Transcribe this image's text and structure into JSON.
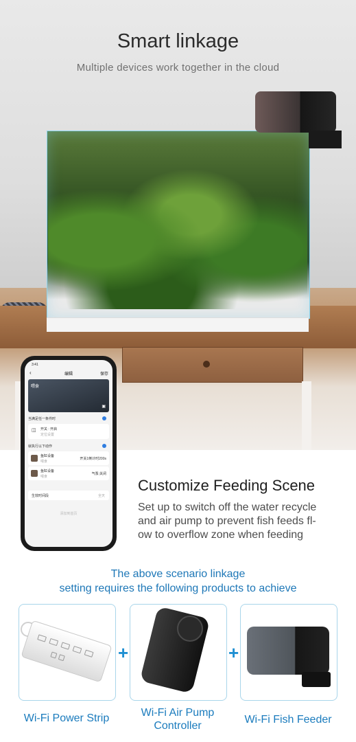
{
  "hero": {
    "title": "Smart linkage",
    "subtitle": "Multiple devices work together in the cloud"
  },
  "phone": {
    "status_time": "3:41",
    "back_icon": "chevron-left-icon",
    "title": "编辑",
    "save_label": "保存",
    "card_label": "喂食",
    "condition_header": "当满足任一条件时",
    "condition_row": "开关 : 开启",
    "condition_sub": "定位设置",
    "action_header": "就执行以下动作",
    "action_rows": [
      {
        "name": "鱼缸设备",
        "sub": "喂食",
        "value": "开关1倒计时200s"
      },
      {
        "name": "鱼缸设备",
        "sub": "喂食",
        "value": "气泵:关闭"
      }
    ],
    "effective_label": "生效时间段",
    "effective_value": "全天",
    "bottom_label": "添加到首页"
  },
  "scene": {
    "title": "Customize Feeding Scene",
    "description_lines": [
      "Set up to switch off the water recycle",
      "and air pump to prevent fish feeds fl-",
      "ow to overflow zone when feeding"
    ]
  },
  "requirement": {
    "line1": "The above scenario linkage",
    "line2": "setting requires the following products to achieve"
  },
  "products": [
    {
      "label": "Wi-Fi Power Strip",
      "image": "power-strip-image"
    },
    {
      "label_line1": "Wi-Fi Air Pump",
      "label_line2": "Controller",
      "image": "air-pump-controller-image"
    },
    {
      "label": "Wi-Fi Fish Feeder",
      "image": "fish-feeder-image"
    }
  ],
  "plus_symbol": "+",
  "colors": {
    "accent_blue": "#1d77b7",
    "box_border": "#a8d5ea",
    "title_dark": "#2b2b2b"
  }
}
